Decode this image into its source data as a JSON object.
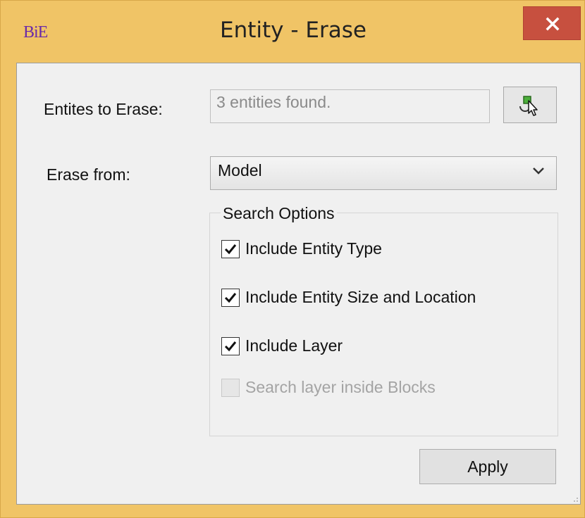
{
  "window": {
    "app_icon_text": "BiE",
    "title": "Entity - Erase"
  },
  "form": {
    "entities_label": "Entites to Erase:",
    "entities_value": "3 entities found.",
    "erase_from_label": "Erase from:",
    "erase_from_selected": "Model"
  },
  "search_options": {
    "title": "Search Options",
    "items": [
      {
        "label": "Include Entity Type",
        "checked": true,
        "enabled": true
      },
      {
        "label": "Include Entity Size and Location",
        "checked": true,
        "enabled": true
      },
      {
        "label": "Include Layer",
        "checked": true,
        "enabled": true
      },
      {
        "label": "Search layer inside Blocks",
        "checked": false,
        "enabled": false
      }
    ]
  },
  "buttons": {
    "apply_label": "Apply"
  },
  "colors": {
    "titlebar": "#f0c466",
    "close_button": "#c7503f",
    "app_icon": "#6a2aa8",
    "client_bg": "#f0f0f0"
  },
  "icons": {
    "close": "close-icon",
    "pick": "select-entities-icon",
    "dropdown": "chevron-down-icon",
    "check": "checkmark-icon"
  }
}
